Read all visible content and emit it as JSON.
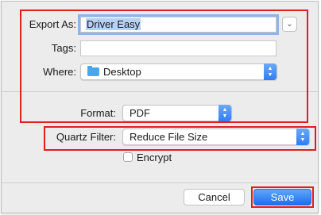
{
  "export_as": {
    "label": "Export As:",
    "value": "Driver Easy"
  },
  "tags": {
    "label": "Tags:",
    "value": ""
  },
  "where": {
    "label": "Where:",
    "value": "Desktop"
  },
  "format": {
    "label": "Format:",
    "value": "PDF"
  },
  "quartz_filter": {
    "label": "Quartz Filter:",
    "value": "Reduce File Size"
  },
  "encrypt": {
    "label": "Encrypt",
    "checked": false
  },
  "buttons": {
    "cancel": "Cancel",
    "save": "Save"
  },
  "icons": {
    "expand": "chevron-down-icon",
    "stepper": "up-down-arrows-icon",
    "folder": "folder-icon"
  },
  "colors": {
    "highlight": "#e01e1e",
    "accent": "#2f7ef0",
    "selection": "#b5d3f8"
  }
}
